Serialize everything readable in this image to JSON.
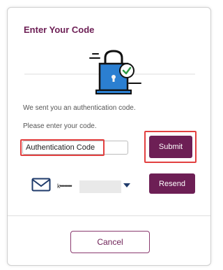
{
  "dialog": {
    "title": "Enter Your Code",
    "message_sent": "We sent you an authentication code.",
    "message_enter": "Please enter your code.",
    "code_input": {
      "value": "Authentication Code",
      "placeholder": ""
    },
    "submit_label": "Submit",
    "delivery": {
      "icon": "envelope-icon",
      "masked_destination": "k••••••••"
    },
    "resend_label": "Resend",
    "cancel_label": "Cancel"
  },
  "colors": {
    "accent": "#6d1f55",
    "highlight": "#e24040",
    "illustration_blue": "#2b7fd1",
    "check_green": "#2e9a45"
  }
}
